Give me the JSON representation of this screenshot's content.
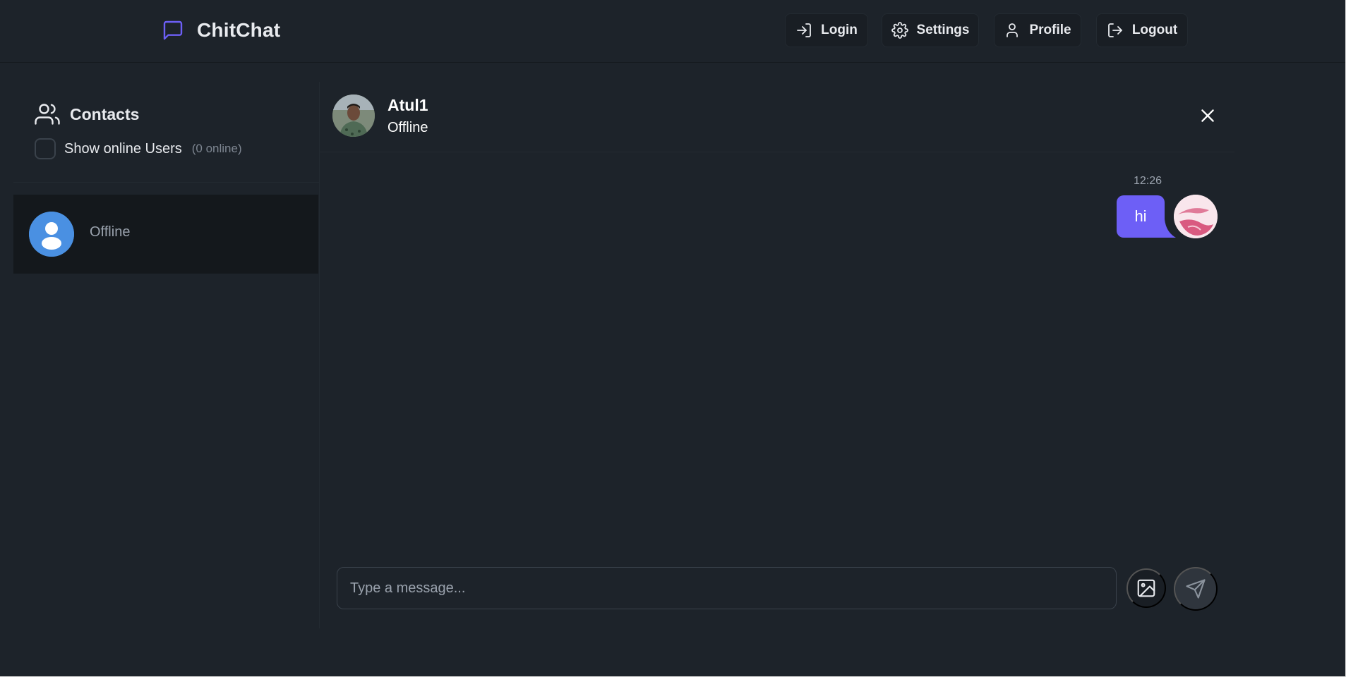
{
  "navbar": {
    "brand": "ChitChat",
    "brand_icon": "message-square-icon",
    "buttons": {
      "login": "Login",
      "settings": "Settings",
      "profile": "Profile",
      "logout": "Logout"
    }
  },
  "sidebar": {
    "title": "Contacts",
    "show_online_label": "Show online Users",
    "online_count": "(0 online)",
    "contacts": [
      {
        "status": "Offline"
      }
    ]
  },
  "chat": {
    "user_name": "Atul1",
    "user_status": "Offline",
    "messages": [
      {
        "time": "12:26",
        "text": "hi",
        "own": true
      }
    ],
    "input_placeholder": "Type a message..."
  },
  "colors": {
    "background": "#1d232a",
    "accent": "#6d5ff6",
    "brand_icon": "#6d5ff6",
    "contact_avatar": "#4a90e2"
  }
}
